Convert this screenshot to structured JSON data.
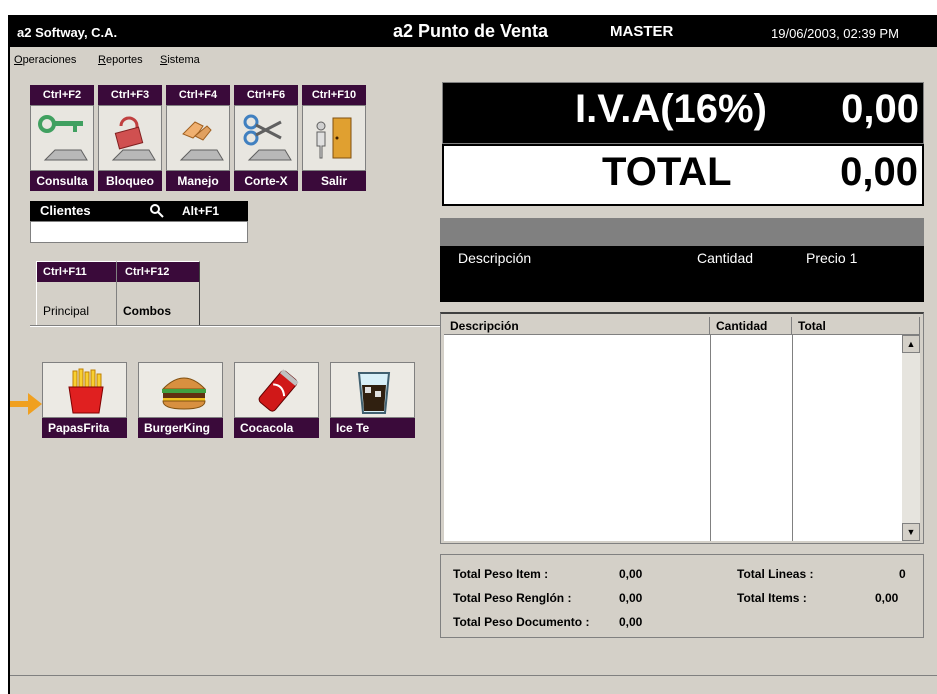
{
  "titlebar": {
    "company": "a2 Softway, C.A.",
    "app": "a2 Punto de Venta",
    "user": "MASTER",
    "datetime": "19/06/2003, 02:39 PM"
  },
  "menu": [
    "Operaciones",
    "Reportes",
    "Sistema"
  ],
  "function_buttons": [
    {
      "key": "Ctrl+F2",
      "label": "Consulta",
      "icon": "key-icon"
    },
    {
      "key": "Ctrl+F3",
      "label": "Bloqueo",
      "icon": "lock-icon"
    },
    {
      "key": "Ctrl+F4",
      "label": "Manejo",
      "icon": "hand-icon"
    },
    {
      "key": "Ctrl+F6",
      "label": "Corte-X",
      "icon": "scissors-icon"
    },
    {
      "key": "Ctrl+F10",
      "label": "Salir",
      "icon": "exit-door-icon"
    }
  ],
  "clientes": {
    "title": "Clientes",
    "shortcut": "Alt+F1",
    "icon": "search-icon",
    "value": ""
  },
  "tabs": [
    {
      "key": "Ctrl+F11",
      "label": "Principal"
    },
    {
      "key": "Ctrl+F12",
      "label": "Combos"
    }
  ],
  "products": [
    {
      "label": "PapasFrita",
      "icon": "french-fries-icon"
    },
    {
      "label": "BurgerKing",
      "icon": "burger-icon"
    },
    {
      "label": "Cocacola",
      "icon": "soda-can-icon"
    },
    {
      "label": "Ice Te",
      "icon": "iced-drink-icon"
    }
  ],
  "display": {
    "iva_label": "I.V.A(16%)",
    "iva_value": "0,00",
    "total_label": "TOTAL",
    "total_value": "0,00"
  },
  "item_info": {
    "descripcion": "Descripción",
    "cantidad": "Cantidad",
    "precio": "Precio 1"
  },
  "grid": {
    "columns": [
      "Descripción",
      "Cantidad",
      "Total"
    ],
    "rows": []
  },
  "totals": {
    "peso_item_label": "Total Peso Item :",
    "peso_item_value": "0,00",
    "peso_renglon_label": "Total Peso Renglón :",
    "peso_renglon_value": "0,00",
    "peso_documento_label": "Total Peso Documento :",
    "peso_documento_value": "0,00",
    "lineas_label": "Total Lineas :",
    "lineas_value": "0",
    "items_label": "Total Items :",
    "items_value": "0,00"
  },
  "colors": {
    "accent": "#3a0a3a",
    "pointer": "#f0a020"
  }
}
